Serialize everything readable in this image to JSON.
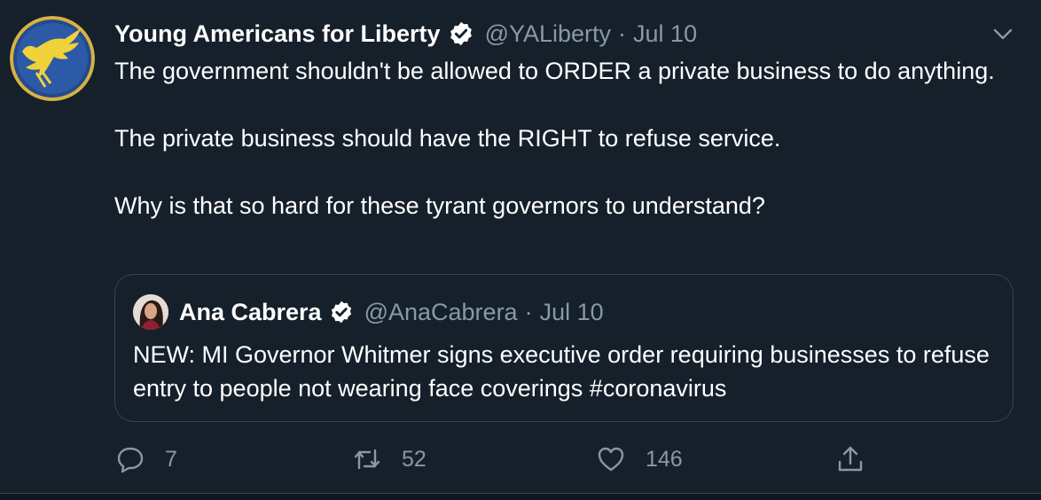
{
  "tweet": {
    "author": {
      "display_name": "Young Americans for Liberty",
      "handle": "@YALiberty",
      "verified": true,
      "avatar_icon": "eagle-logo-icon"
    },
    "date": "Jul 10",
    "separator": "·",
    "text": [
      "The government shouldn't be allowed to ORDER a private business to do anything.",
      "The private business should have the RIGHT to refuse service.",
      "Why is that so hard for these tyrant governors to understand?"
    ],
    "quoted_tweet": {
      "author": {
        "display_name": "Ana Cabrera",
        "handle": "@AnaCabrera",
        "verified": true,
        "avatar_icon": "profile-photo-icon"
      },
      "date": "Jul 10",
      "separator": "·",
      "text": "NEW: MI Governor Whitmer signs executive order requiring businesses to refuse entry to people not wearing face coverings #coronavirus"
    },
    "actions": {
      "replies": "7",
      "retweets": "52",
      "likes": "146"
    }
  },
  "colors": {
    "background": "#15202b",
    "secondary_text": "#8899a6",
    "border": "#38444d",
    "verified_badge": "#ffffff"
  }
}
